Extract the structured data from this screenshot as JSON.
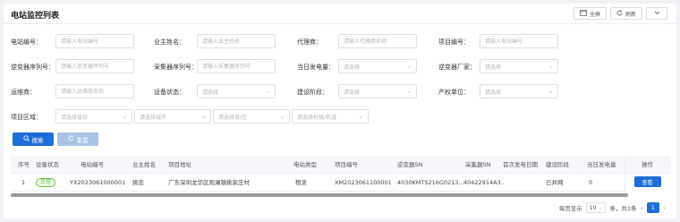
{
  "page": {
    "title": "电站监控列表",
    "actions": {
      "fullscreen": "全屏",
      "refresh": "刷新"
    }
  },
  "filters": {
    "station_no": {
      "label": "电站编号：",
      "placeholder": "请输入电站编号"
    },
    "owner_name": {
      "label": "业主姓名：",
      "placeholder": "请输入业主姓名"
    },
    "agent": {
      "label": "代理商：",
      "placeholder": "请输入代理商名称"
    },
    "project_no": {
      "label": "项目编号：",
      "placeholder": "请输入电站编号"
    },
    "inverter_sn": {
      "label": "逆变器序列号：",
      "placeholder": "请输入逆变器序列号"
    },
    "collector_sn": {
      "label": "采集器序列号：",
      "placeholder": "请输入采集器序列号"
    },
    "daily_power": {
      "label": "当日发电量：",
      "placeholder": "请选择"
    },
    "inverter_vendor": {
      "label": "逆变器厂家：",
      "placeholder": "请选择"
    },
    "ops_vendor": {
      "label": "运维商：",
      "placeholder": "请输入运维商名称"
    },
    "device_status": {
      "label": "设备状态：",
      "placeholder": "请选择"
    },
    "build_stage": {
      "label": "建设阶段：",
      "placeholder": "请选择"
    },
    "owner_unit": {
      "label": "产权单位：",
      "placeholder": "请选择"
    },
    "region": {
      "label": "项目区域：",
      "province": "请选择省份",
      "city": "请选择城市",
      "district": "请选择县/区",
      "village": "请选择村镇/街道"
    }
  },
  "buttons": {
    "search": "搜索",
    "reset": "重置"
  },
  "table": {
    "headers": {
      "index": "序号",
      "device_status": "设备状态",
      "station_no": "电站编号",
      "owner_name": "业主姓名",
      "address": "项目地址",
      "station_type": "电站类型",
      "project_no": "项目编号",
      "inverter_sn": "逆变器SN",
      "collector_sn": "采集器SN",
      "first_gen_date": "首次发电日期",
      "build_stage": "建设阶段",
      "daily_power": "当日发电量",
      "operation": "操作"
    },
    "rows": [
      {
        "index": "1",
        "device_status": "正常",
        "station_no": "YX2023061000001",
        "owner_name": "姚忠",
        "address": "广东深圳龙华区观澜镇姚家庄村",
        "station_type": "租赁",
        "project_no": "XM2023061100001",
        "inverter_sn": "4030KMTS216G0213...",
        "collector_sn": "40422914A3...",
        "first_gen_date": "",
        "build_stage": "已并网",
        "daily_power": "0",
        "operation": "查看"
      }
    ]
  },
  "pagination": {
    "page_size_label": "每页显示",
    "page_size": "10",
    "total_label": "条，共1条",
    "current_page": "1"
  },
  "colors": {
    "primary": "#1e6fd9",
    "status_ok": "#67c23a"
  }
}
